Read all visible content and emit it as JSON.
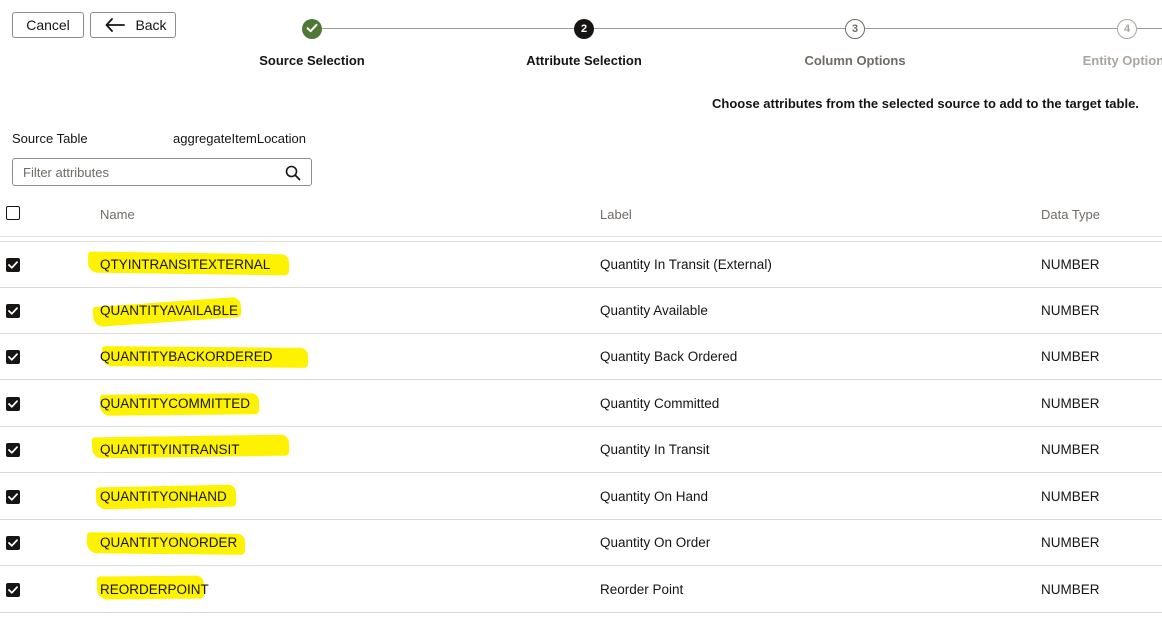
{
  "toolbar": {
    "cancel_label": "Cancel",
    "back_label": "Back"
  },
  "train": {
    "steps": [
      {
        "number": "",
        "label": "Source Selection",
        "state": "completed"
      },
      {
        "number": "2",
        "label": "Attribute Selection",
        "state": "current"
      },
      {
        "number": "3",
        "label": "Column Options",
        "state": "pending"
      },
      {
        "number": "4",
        "label": "Entity Options",
        "state": "pending"
      }
    ]
  },
  "instruction": "Choose attributes from the selected source to add to the target table.",
  "source": {
    "label": "Source Table",
    "value": "aggregateItemLocation"
  },
  "filter": {
    "placeholder": "Filter attributes",
    "value": ""
  },
  "table": {
    "columns": [
      "Name",
      "Label",
      "Data Type"
    ],
    "rows": [
      {
        "name": "QTYINTRANSITEXTERNAL",
        "label": "Quantity In Transit (External)",
        "type": "NUMBER",
        "checked": true
      },
      {
        "name": "QUANTITYAVAILABLE",
        "label": "Quantity Available",
        "type": "NUMBER",
        "checked": true
      },
      {
        "name": "QUANTITYBACKORDERED",
        "label": "Quantity Back Ordered",
        "type": "NUMBER",
        "checked": true
      },
      {
        "name": "QUANTITYCOMMITTED",
        "label": "Quantity Committed",
        "type": "NUMBER",
        "checked": true
      },
      {
        "name": "QUANTITYINTRANSIT",
        "label": "Quantity In Transit",
        "type": "NUMBER",
        "checked": true
      },
      {
        "name": "QUANTITYONHAND",
        "label": "Quantity On Hand",
        "type": "NUMBER",
        "checked": true
      },
      {
        "name": "QUANTITYONORDER",
        "label": "Quantity On Order",
        "type": "NUMBER",
        "checked": true
      },
      {
        "name": "REORDERPOINT",
        "label": "Reorder Point",
        "type": "NUMBER",
        "checked": true
      }
    ]
  },
  "colors": {
    "completed": "#4d7935",
    "current": "#161513",
    "highlight": "#fff200"
  }
}
